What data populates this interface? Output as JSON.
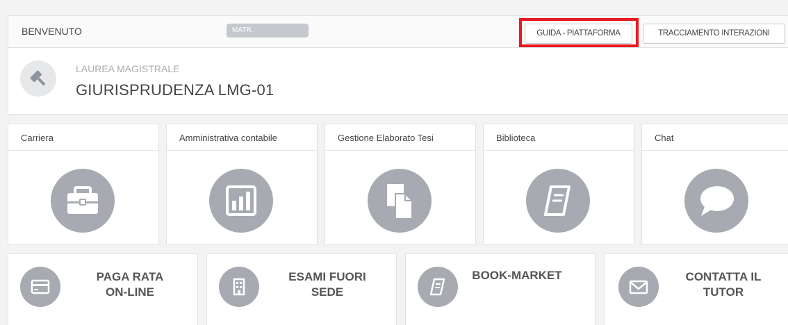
{
  "header": {
    "welcome": "BENVENUTO",
    "matr_label": "MATR.",
    "guide_button": "GUIDA - PIATTAFORMA",
    "tracking_button": "TRACCIAMENTO INTERAZIONI",
    "degree_type": "LAUREA MAGISTRALE",
    "course_name": "GIURISPRUDENZA LMG-01",
    "course_icon": "gavel-icon"
  },
  "tiles": [
    {
      "label": "Carriera",
      "icon": "briefcase-icon"
    },
    {
      "label": "Amministrativa contabile",
      "icon": "bar-chart-icon"
    },
    {
      "label": "Gestione Elaborato Tesi",
      "icon": "documents-icon"
    },
    {
      "label": "Biblioteca",
      "icon": "book-icon"
    },
    {
      "label": "Chat",
      "icon": "chat-bubble-icon"
    }
  ],
  "cards": [
    {
      "line1": "PAGA RATA",
      "line2": "ON-LINE",
      "icon": "credit-card-icon"
    },
    {
      "line1": "ESAMI FUORI",
      "line2": "SEDE",
      "icon": "building-icon"
    },
    {
      "line1": "BOOK-MARKET",
      "line2": "",
      "icon": "book-icon"
    },
    {
      "line1": "CONTATTA IL",
      "line2": "TUTOR",
      "icon": "envelope-icon"
    }
  ],
  "colors": {
    "highlight": "#e8191f",
    "icon_circle": "#a7abb1",
    "course_text": "#444444"
  }
}
